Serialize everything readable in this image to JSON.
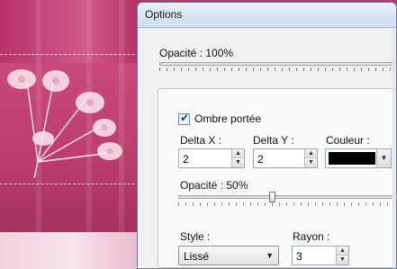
{
  "window": {
    "title": "Options"
  },
  "top_opacity": {
    "label": "Opacité : 100%",
    "value_percent": 100
  },
  "shadow": {
    "checkbox_label": "Ombre portée",
    "checked": true,
    "delta_x_label": "Delta X :",
    "delta_x_value": "2",
    "delta_y_label": "Delta Y :",
    "delta_y_value": "2",
    "color_label": "Couleur :",
    "color_value": "#000000",
    "opacity_label": "Opacité : 50%",
    "opacity_value_percent": 50,
    "style_label": "Style :",
    "style_value": "Lissé",
    "radius_label": "Rayon :",
    "radius_value": "3"
  },
  "colors": {
    "canvas_pink": "#b23a66",
    "dialog_bg": "#f0f0f0",
    "title_blue": "#dbe6f3"
  }
}
